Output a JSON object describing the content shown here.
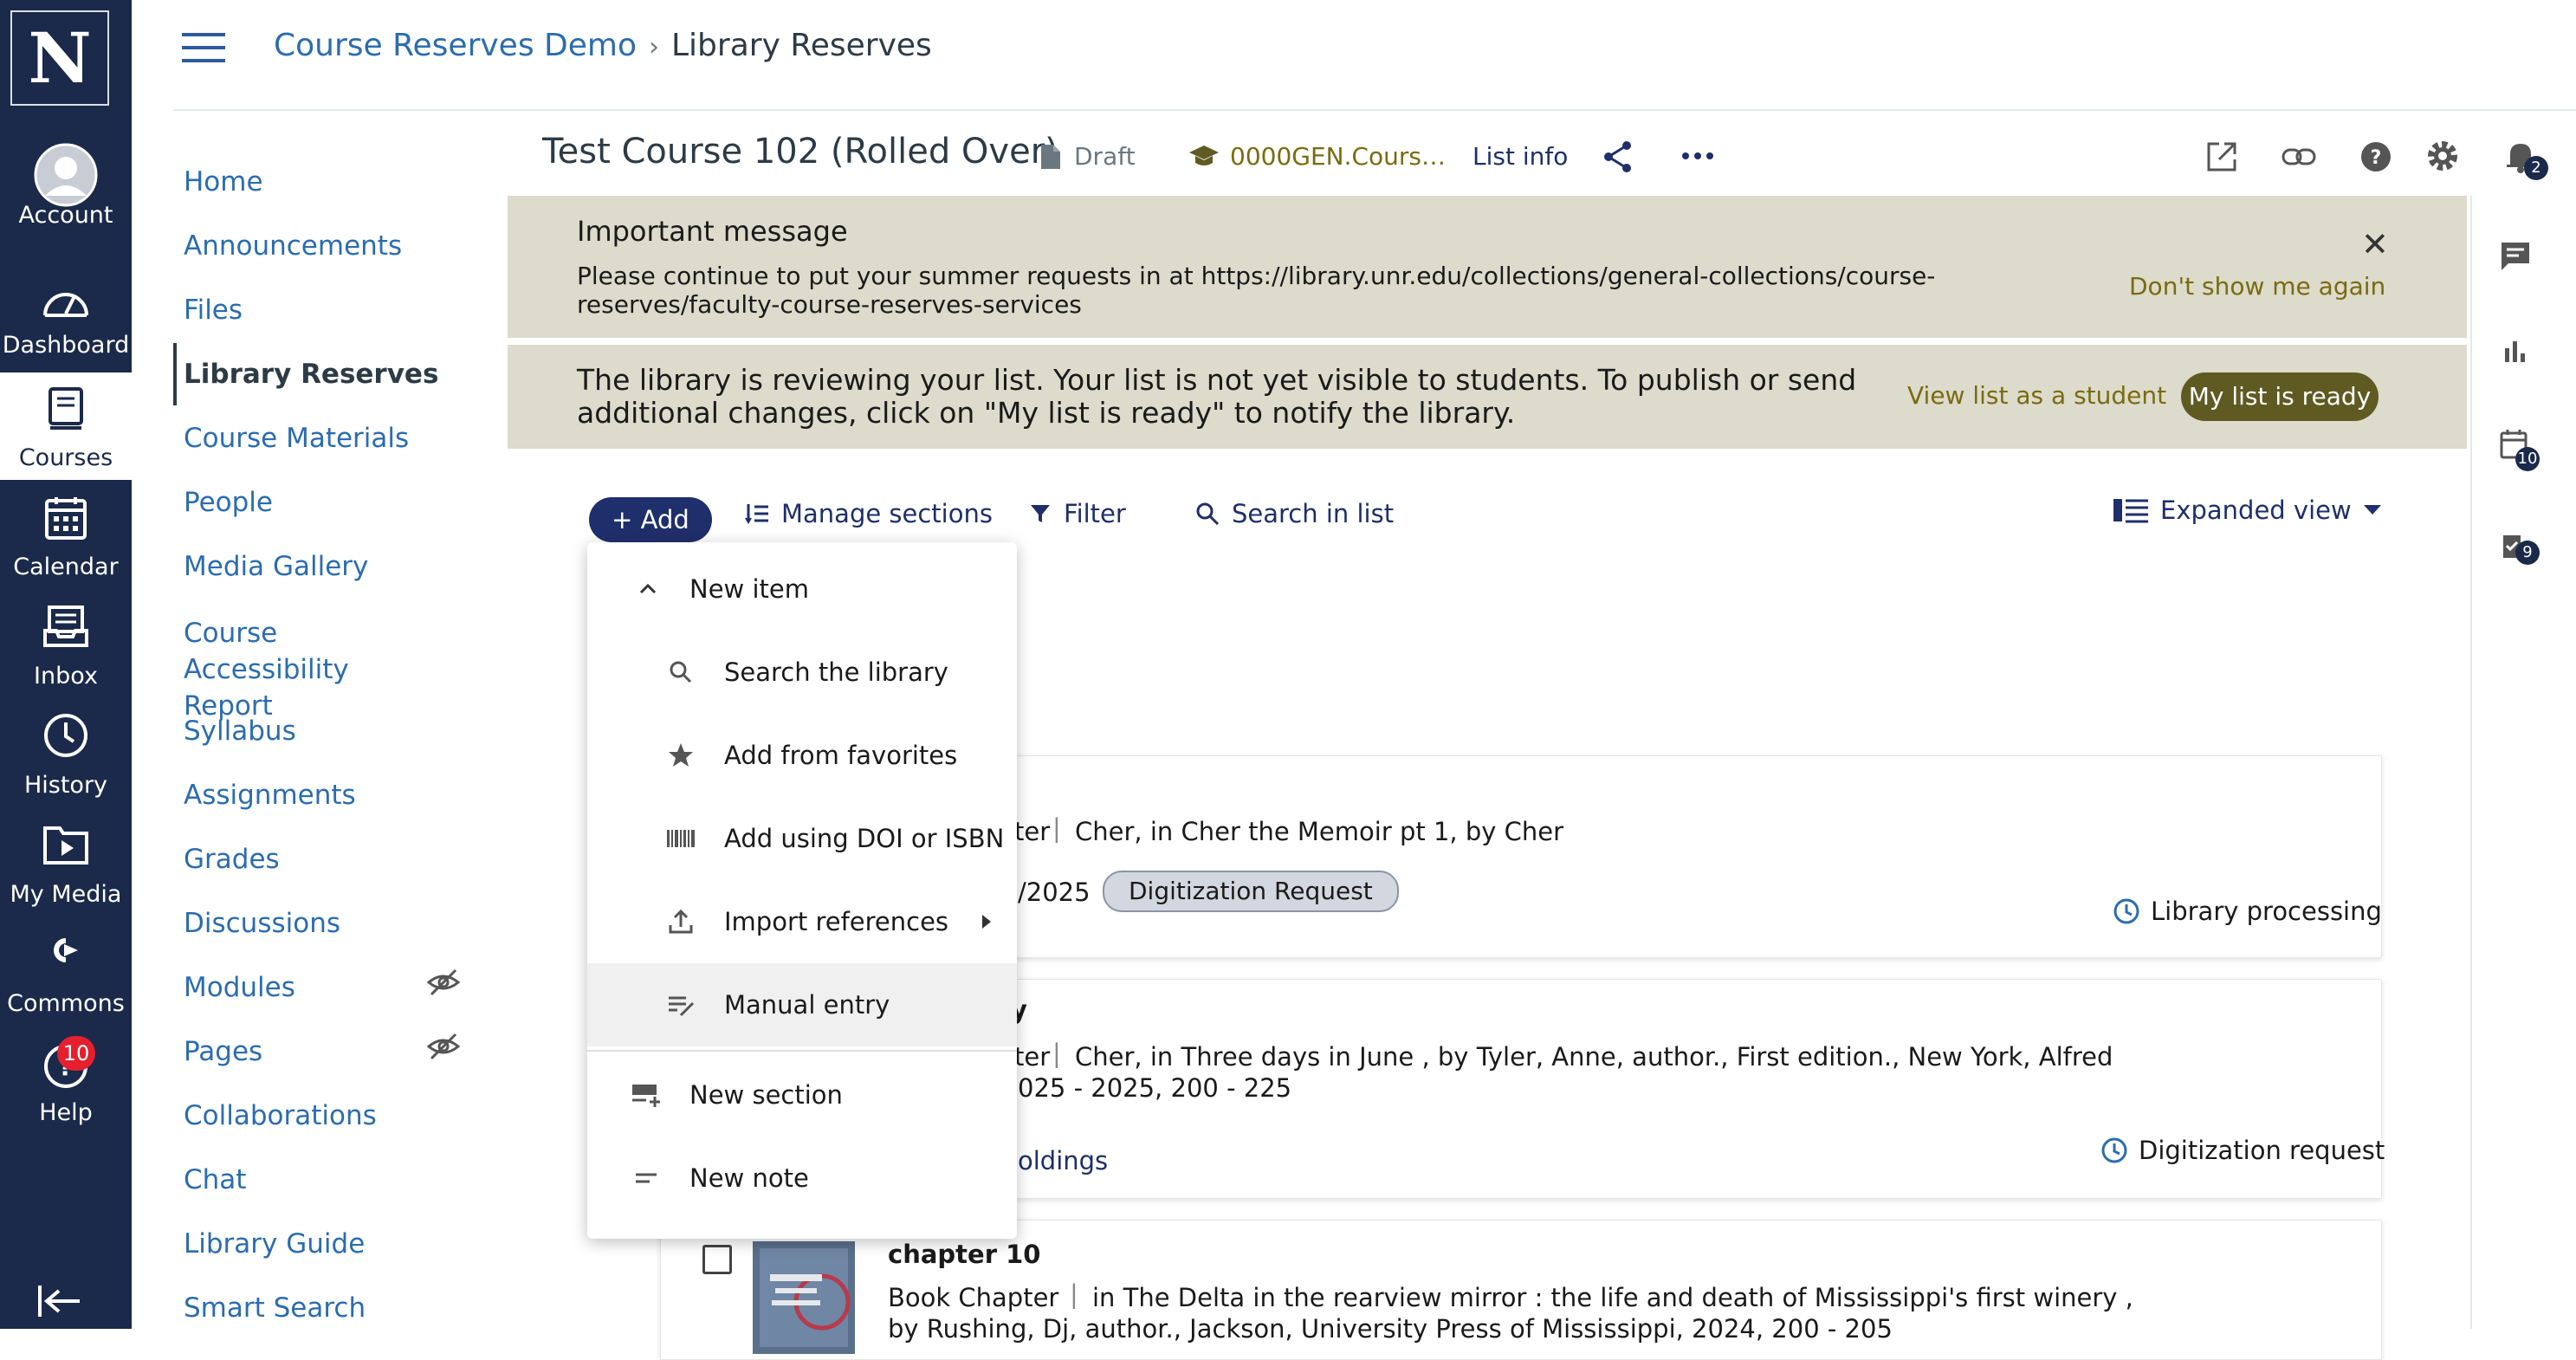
{
  "global_nav": {
    "logo": "N",
    "items": [
      {
        "label": "Account",
        "icon": "account-icon"
      },
      {
        "label": "Dashboard",
        "icon": "dashboard-icon"
      },
      {
        "label": "Courses",
        "icon": "courses-icon"
      },
      {
        "label": "Calendar",
        "icon": "calendar-icon"
      },
      {
        "label": "Inbox",
        "icon": "inbox-icon"
      },
      {
        "label": "History",
        "icon": "history-icon"
      },
      {
        "label": "My Media",
        "icon": "my-media-icon"
      },
      {
        "label": "Commons",
        "icon": "commons-icon"
      },
      {
        "label": "Help",
        "icon": "help-icon",
        "badge": "10"
      }
    ]
  },
  "breadcrumb": {
    "course": "Course Reserves Demo",
    "page": "Library Reserves"
  },
  "course_nav": [
    {
      "label": "Home"
    },
    {
      "label": "Announcements"
    },
    {
      "label": "Files"
    },
    {
      "label": "Library Reserves",
      "active": true
    },
    {
      "label": "Course Materials"
    },
    {
      "label": "People"
    },
    {
      "label": "Media Gallery"
    },
    {
      "label": "Course Accessibility Report"
    },
    {
      "label": "Syllabus"
    },
    {
      "label": "Assignments"
    },
    {
      "label": "Grades"
    },
    {
      "label": "Discussions"
    },
    {
      "label": "Modules",
      "hidden": true
    },
    {
      "label": "Pages",
      "hidden": true
    },
    {
      "label": "Collaborations"
    },
    {
      "label": "Chat"
    },
    {
      "label": "Library Guide"
    },
    {
      "label": "Smart Search"
    }
  ],
  "header": {
    "title": "Test Course 102 (Rolled Over)",
    "status": "Draft",
    "course_code": "0000GEN.Cours…",
    "list_info": "List info"
  },
  "banner_important": {
    "heading": "Important message",
    "body": "Please continue to put your summer requests in at https://library.unr.edu/collections/general-collections/course-reserves/faculty-course-reserves-services",
    "dismiss": "Don't show me again"
  },
  "banner_review": {
    "text": "The library is reviewing your list. Your list is not yet visible to students. To publish or send additional changes, click on \"My list is ready\" to notify the library.",
    "view_as_student": "View list as a student",
    "ready_button": "My list is ready"
  },
  "toolbar": {
    "add": "+ Add",
    "manage_sections": "Manage sections",
    "filter": "Filter",
    "search": "Search in list",
    "view": "Expanded view"
  },
  "add_menu": {
    "new_item": "New item",
    "search_library": "Search the library",
    "favorites": "Add from favorites",
    "doi_isbn": "Add using DOI or ISBN",
    "import": "Import references",
    "manual": "Manual entry",
    "new_section": "New section",
    "new_note": "New note"
  },
  "items": [
    {
      "type_fragment": "ter",
      "citation": "Cher, in Cher the Memoir pt 1, by Cher",
      "date_fragment": "/2025",
      "tag": "Digitization Request",
      "status": "Library processing"
    },
    {
      "title_fragment": "y",
      "type_fragment": "ter",
      "citation": "Cher, in Three days in June , by Tyler, Anne, author., First edition., New York, Alfred",
      "pages_fragment": "025 - 2025, 200 - 225",
      "link_fragment": "oldings",
      "status": "Digitization request"
    },
    {
      "title": "chapter 10",
      "type": "Book Chapter",
      "citation": "in The Delta in the rearview mirror : the life and death of Mississippi's first winery ,",
      "citation2": "by Rushing, Dj, author., Jackson, University Press of Mississippi, 2024, 200 - 205"
    }
  ],
  "right_rail": {
    "notifications_badge": "2",
    "calendar_badge": "10",
    "tasks_badge": "9"
  },
  "colors": {
    "nav_bg": "#1b2a4a",
    "accent": "#1f2f6b",
    "banner_bg": "#dcdbcc",
    "ready_button": "#5e5a22",
    "link": "#2b6cb0"
  }
}
